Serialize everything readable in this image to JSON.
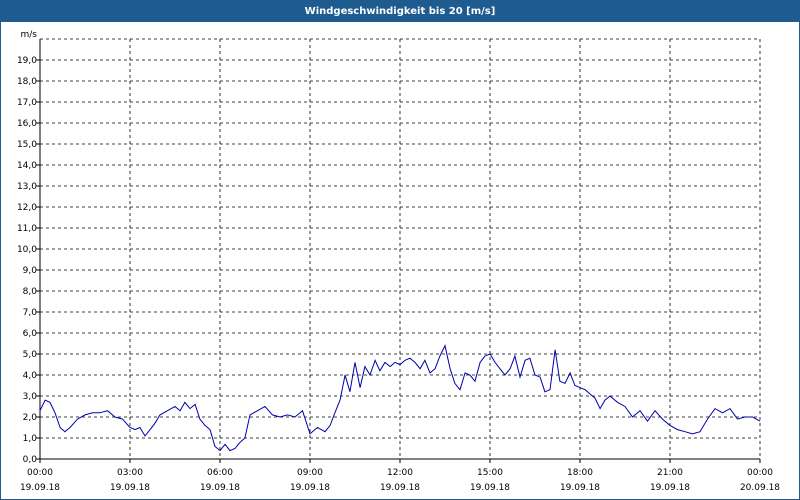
{
  "window": {
    "title": "Windgeschwindigkeit bis 20 [m/s]"
  },
  "chart_data": {
    "type": "line",
    "title": "Windgeschwindigkeit bis 20 [m/s]",
    "ylabel": "m/s",
    "ylim": [
      0,
      20
    ],
    "xlim_hours": [
      0,
      24
    ],
    "grid": true,
    "y_ticks": [
      "0,0",
      "1,0",
      "2,0",
      "3,0",
      "4,0",
      "5,0",
      "6,0",
      "7,0",
      "8,0",
      "9,0",
      "10,0",
      "11,0",
      "12,0",
      "13,0",
      "14,0",
      "15,0",
      "16,0",
      "17,0",
      "18,0",
      "19,0"
    ],
    "x_ticks": [
      {
        "time": "00:00",
        "date": "19.09.18"
      },
      {
        "time": "03:00",
        "date": "19.09.18"
      },
      {
        "time": "06:00",
        "date": "19.09.18"
      },
      {
        "time": "09:00",
        "date": "19.09.18"
      },
      {
        "time": "12:00",
        "date": "19.09.18"
      },
      {
        "time": "15:00",
        "date": "19.09.18"
      },
      {
        "time": "18:00",
        "date": "19.09.18"
      },
      {
        "time": "21:00",
        "date": "19.09.18"
      },
      {
        "time": "00:00",
        "date": "20.09.18"
      }
    ],
    "series": [
      {
        "color": "#0000aa",
        "x": [
          0.0,
          0.17,
          0.33,
          0.5,
          0.67,
          0.83,
          1.0,
          1.25,
          1.5,
          1.75,
          2.0,
          2.25,
          2.5,
          2.75,
          3.0,
          3.17,
          3.33,
          3.5,
          3.67,
          3.83,
          4.0,
          4.25,
          4.5,
          4.67,
          4.83,
          5.0,
          5.17,
          5.33,
          5.5,
          5.67,
          5.83,
          6.0,
          6.17,
          6.33,
          6.5,
          6.67,
          6.83,
          7.0,
          7.25,
          7.5,
          7.75,
          8.0,
          8.25,
          8.5,
          8.75,
          9.0,
          9.25,
          9.5,
          9.67,
          9.83,
          10.0,
          10.17,
          10.33,
          10.5,
          10.67,
          10.83,
          11.0,
          11.17,
          11.33,
          11.5,
          11.67,
          11.83,
          12.0,
          12.17,
          12.33,
          12.5,
          12.67,
          12.83,
          13.0,
          13.17,
          13.33,
          13.5,
          13.67,
          13.83,
          14.0,
          14.17,
          14.33,
          14.5,
          14.67,
          14.83,
          15.0,
          15.17,
          15.33,
          15.5,
          15.67,
          15.83,
          16.0,
          16.17,
          16.33,
          16.5,
          16.67,
          16.83,
          17.0,
          17.17,
          17.33,
          17.5,
          17.67,
          17.83,
          18.0,
          18.17,
          18.33,
          18.5,
          18.67,
          18.83,
          19.0,
          19.25,
          19.5,
          19.75,
          20.0,
          20.25,
          20.5,
          20.75,
          21.0,
          21.25,
          21.5,
          21.75,
          22.0,
          22.25,
          22.5,
          22.75,
          23.0,
          23.25,
          23.5,
          23.75,
          24.0
        ],
        "values": [
          2.3,
          2.8,
          2.7,
          2.2,
          1.5,
          1.3,
          1.5,
          1.9,
          2.1,
          2.2,
          2.2,
          2.3,
          2.0,
          1.9,
          1.5,
          1.4,
          1.5,
          1.1,
          1.4,
          1.7,
          2.1,
          2.3,
          2.5,
          2.3,
          2.7,
          2.4,
          2.6,
          1.9,
          1.6,
          1.4,
          0.6,
          0.4,
          0.7,
          0.4,
          0.5,
          0.8,
          1.0,
          2.1,
          2.3,
          2.5,
          2.1,
          2.0,
          2.1,
          2.0,
          2.3,
          1.2,
          1.5,
          1.3,
          1.6,
          2.2,
          2.8,
          4.0,
          3.2,
          4.6,
          3.4,
          4.4,
          4.0,
          4.7,
          4.2,
          4.6,
          4.4,
          4.6,
          4.5,
          4.7,
          4.8,
          4.6,
          4.3,
          4.7,
          4.1,
          4.3,
          4.9,
          5.4,
          4.3,
          3.6,
          3.3,
          4.1,
          4.0,
          3.7,
          4.6,
          4.9,
          5.0,
          4.6,
          4.3,
          4.0,
          4.3,
          4.9,
          3.9,
          4.7,
          4.8,
          4.0,
          3.9,
          3.2,
          3.3,
          5.2,
          3.7,
          3.6,
          4.1,
          3.5,
          3.4,
          3.3,
          3.1,
          2.9,
          2.4,
          2.8,
          3.0,
          2.7,
          2.5,
          2.0,
          2.3,
          1.8,
          2.3,
          1.9,
          1.6,
          1.4,
          1.3,
          1.2,
          1.3,
          1.9,
          2.4,
          2.2,
          2.4,
          1.9,
          2.0,
          2.0,
          1.8
        ]
      }
    ]
  }
}
